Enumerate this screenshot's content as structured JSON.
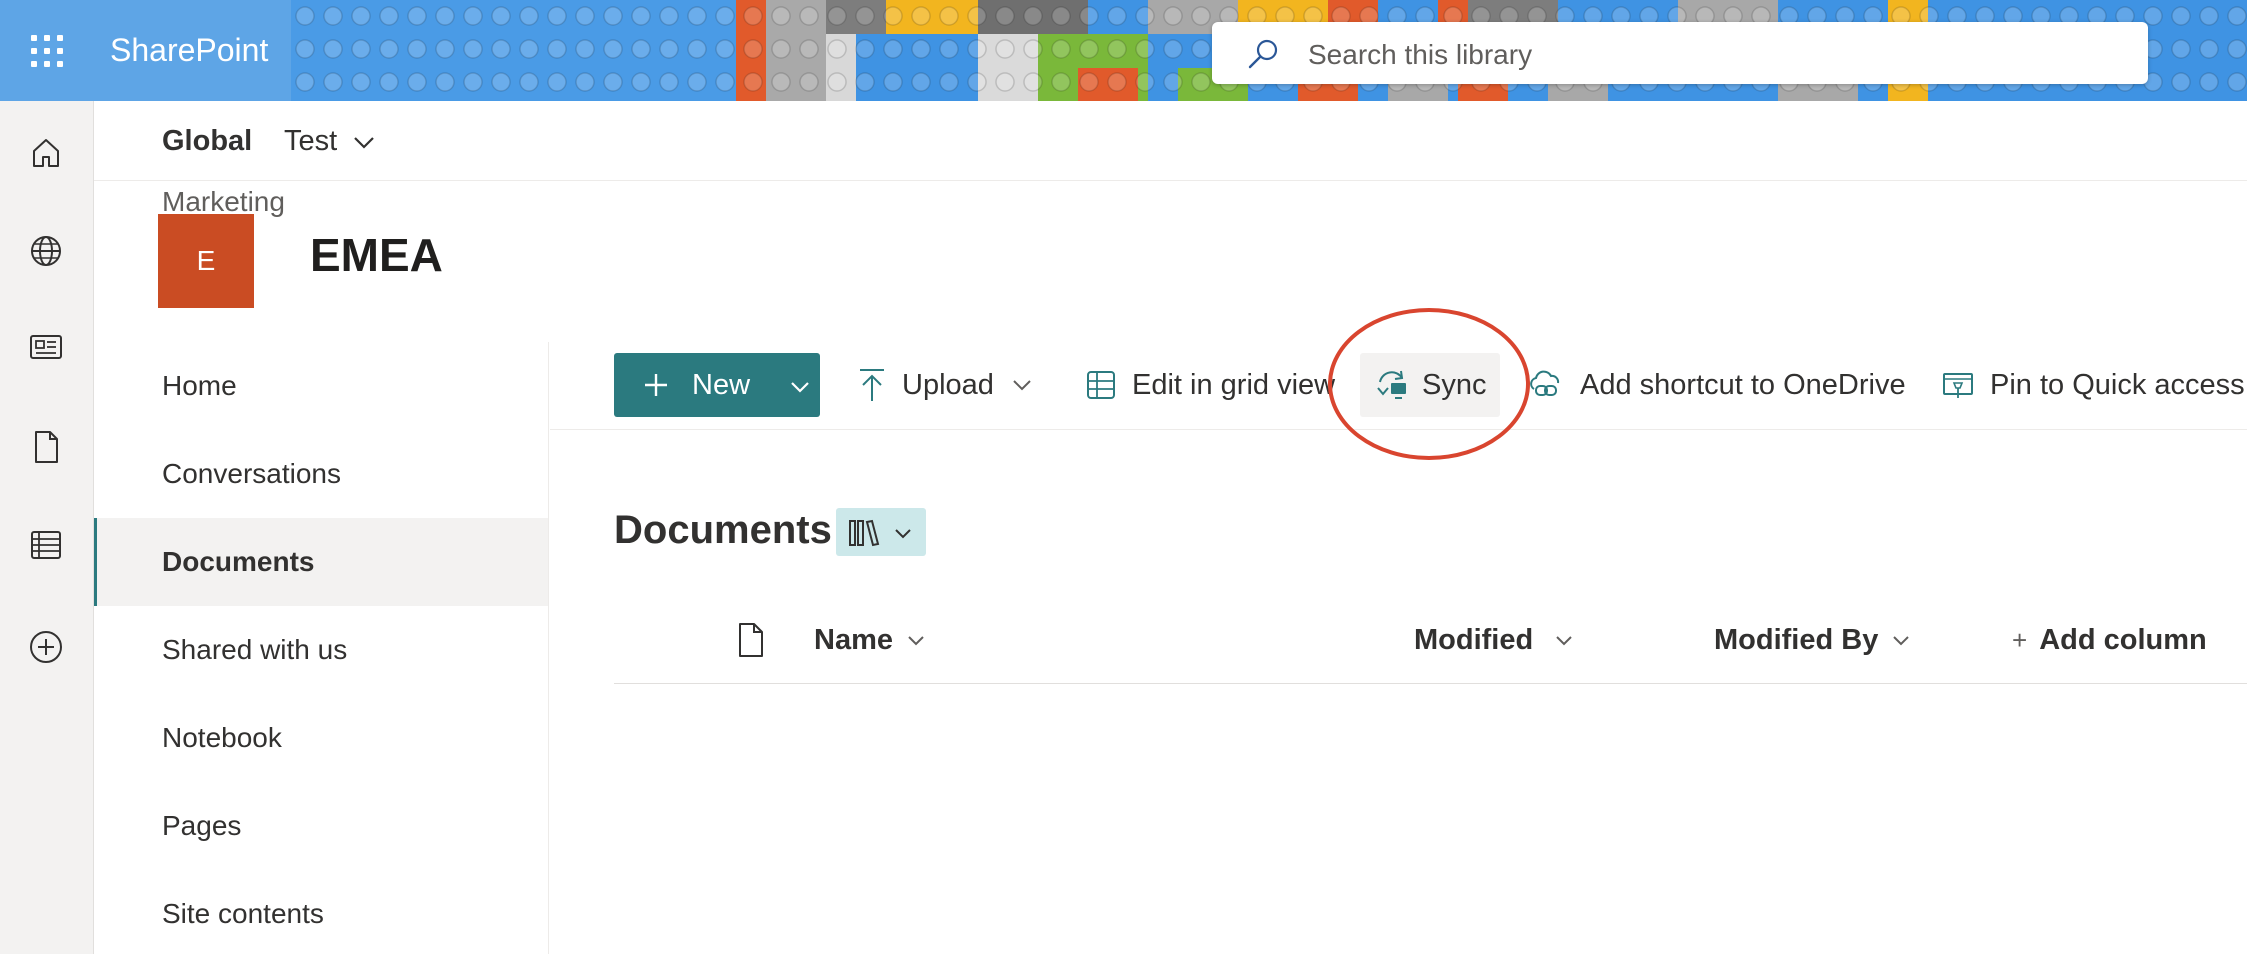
{
  "app": {
    "name": "SharePoint"
  },
  "search": {
    "placeholder": "Search this library"
  },
  "rail": {
    "icons": [
      "home-icon",
      "globe-icon",
      "news-icon",
      "file-icon",
      "list-icon",
      "add-circle-icon"
    ]
  },
  "hub_nav": {
    "global_label": "Global",
    "test_label": "Test"
  },
  "site": {
    "parent_label": "Marketing",
    "logo_letter": "E",
    "logo_color": "#ca4c23",
    "title": "EMEA"
  },
  "left_nav": {
    "items": [
      {
        "label": "Home"
      },
      {
        "label": "Conversations"
      },
      {
        "label": "Documents",
        "selected": true
      },
      {
        "label": "Shared with us"
      },
      {
        "label": "Notebook"
      },
      {
        "label": "Pages"
      },
      {
        "label": "Site contents"
      }
    ]
  },
  "command_bar": {
    "new_label": "New",
    "upload_label": "Upload",
    "edit_grid_label": "Edit in grid view",
    "sync_label": "Sync",
    "add_shortcut_label": "Add shortcut to OneDrive",
    "pin_label": "Pin to Quick access"
  },
  "library": {
    "title": "Documents",
    "columns": {
      "name": "Name",
      "modified": "Modified",
      "modified_by": "Modified By",
      "add_column": "Add column"
    }
  },
  "colors": {
    "accent": "#2b7a7f",
    "suite_bar": "#5ea5e6",
    "annotation": "#d9452f"
  }
}
